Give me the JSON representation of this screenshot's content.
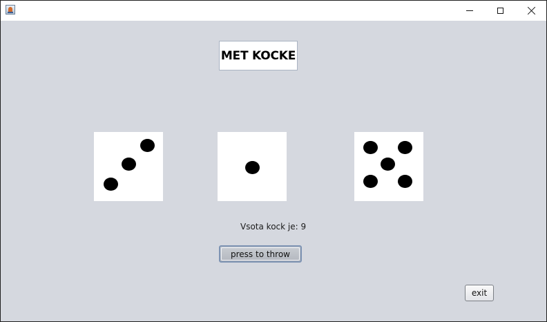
{
  "window": {
    "title": "",
    "controls": [
      "minimize",
      "maximize",
      "close"
    ],
    "background": "#d5d8df"
  },
  "heading": {
    "text": "MET KOCKE"
  },
  "dice": [
    {
      "value": 3
    },
    {
      "value": 1
    },
    {
      "value": 5
    }
  ],
  "sum": {
    "label": "Vsota kock je: 9"
  },
  "buttons": {
    "throw_label": "press to throw",
    "exit_label": "exit"
  },
  "icons": {
    "app": "java-cup-icon",
    "minimize": "minimize-icon",
    "maximize": "maximize-icon",
    "close": "close-icon",
    "pip": "die-pip"
  }
}
